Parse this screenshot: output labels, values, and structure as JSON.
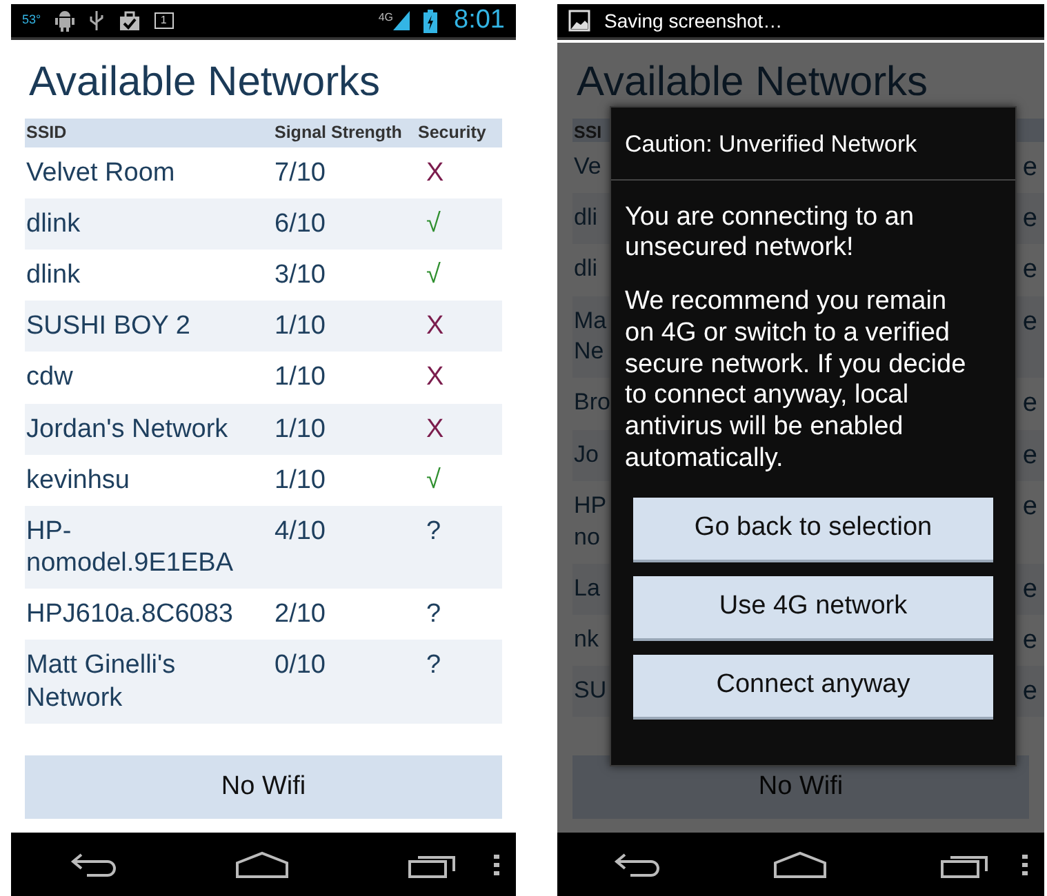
{
  "left_screen": {
    "status_bar": {
      "temperature": "53°",
      "calendar_day": "1",
      "network": "4G",
      "time": "8:01"
    },
    "title": "Available Networks",
    "columns": [
      "SSID",
      "Signal Strength",
      "Security"
    ],
    "networks": [
      {
        "ssid": "Velvet Room",
        "signal": "7/10",
        "security": {
          "kind": "open",
          "symbol": "X"
        }
      },
      {
        "ssid": "dlink",
        "signal": "6/10",
        "security": {
          "kind": "secure",
          "symbol": "√"
        }
      },
      {
        "ssid": "dlink",
        "signal": "3/10",
        "security": {
          "kind": "secure",
          "symbol": "√"
        }
      },
      {
        "ssid": "SUSHI BOY 2",
        "signal": "1/10",
        "security": {
          "kind": "open",
          "symbol": "X"
        }
      },
      {
        "ssid": "cdw",
        "signal": "1/10",
        "security": {
          "kind": "open",
          "symbol": "X"
        }
      },
      {
        "ssid": "Jordan's Network",
        "signal": "1/10",
        "security": {
          "kind": "open",
          "symbol": "X"
        }
      },
      {
        "ssid": "kevinhsu",
        "signal": "1/10",
        "security": {
          "kind": "secure",
          "symbol": "√"
        }
      },
      {
        "ssid": "HP-nomodel.9E1EBA",
        "signal": "4/10",
        "security": {
          "kind": "unknown",
          "symbol": "?"
        }
      },
      {
        "ssid": "HPJ610a.8C6083",
        "signal": "2/10",
        "security": {
          "kind": "unknown",
          "symbol": "?"
        }
      },
      {
        "ssid": "Matt Ginelli's Network",
        "signal": "0/10",
        "security": {
          "kind": "unknown",
          "symbol": "?"
        }
      }
    ],
    "button": "No Wifi"
  },
  "right_screen": {
    "notification": "Saving screenshot…",
    "title": "Available Networks",
    "header_fragment": "SSI",
    "rows": [
      {
        "lines": [
          "Ve"
        ],
        "end": "e"
      },
      {
        "lines": [
          "dli"
        ],
        "end": "e"
      },
      {
        "lines": [
          "dli"
        ],
        "end": "e"
      },
      {
        "lines": [
          "Ma",
          "Ne"
        ],
        "end": "e"
      },
      {
        "lines": [
          "Bro"
        ],
        "end": "e"
      },
      {
        "lines": [
          "Jo"
        ],
        "end": "e"
      },
      {
        "lines": [
          "HP",
          "no"
        ],
        "end": "e"
      },
      {
        "lines": [
          "La"
        ],
        "end": "e"
      },
      {
        "lines": [
          "nk"
        ],
        "end": "e"
      },
      {
        "lines": [
          "SU"
        ],
        "end": "e"
      }
    ],
    "button": "No Wifi",
    "dialog": {
      "title": "Caution: Unverified Network",
      "paragraphs": [
        "You are connecting to an unsecured network!",
        "We recommend you remain on 4G or switch to a verified secure network. If you decide to connect anyway, local antivirus will be enabled automatically."
      ],
      "buttons": [
        "Go back to selection",
        "Use 4G network",
        "Connect anyway"
      ]
    }
  }
}
